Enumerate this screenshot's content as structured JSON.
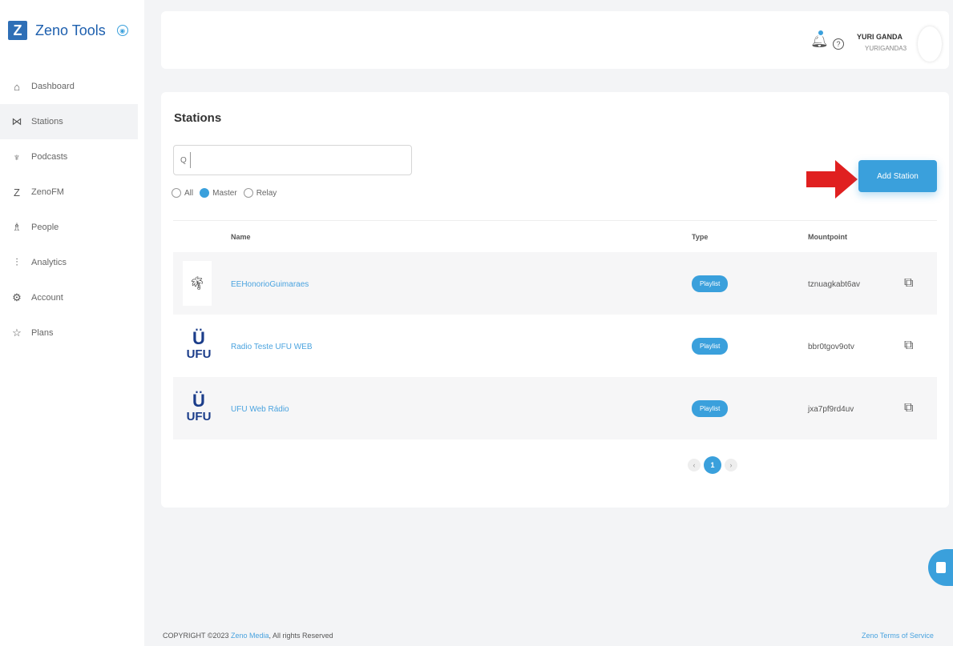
{
  "brand": {
    "logo": "Z",
    "name": "Zeno Tools",
    "toggle_icon": "collapse-circle-icon"
  },
  "sidebar": {
    "items": [
      {
        "label": "Dashboard",
        "icon": "⌂"
      },
      {
        "label": "Stations",
        "icon": "⋈"
      },
      {
        "label": "Podcasts",
        "icon": "♆"
      },
      {
        "label": "ZenoFM",
        "icon": "Z"
      },
      {
        "label": "People",
        "icon": "♗"
      },
      {
        "label": "Analytics",
        "icon": "⫶"
      },
      {
        "label": "Account",
        "icon": "⚙"
      },
      {
        "label": "Plans",
        "icon": "☆"
      }
    ],
    "active_index": 1
  },
  "header": {
    "user_name": "YURI GANDA",
    "user_handle": "YURIGANDA3"
  },
  "stations": {
    "title": "Stations",
    "search": {
      "placeholder": "",
      "value": ""
    },
    "filters": [
      {
        "label": "All",
        "checked": false
      },
      {
        "label": "Master",
        "checked": true
      },
      {
        "label": "Relay",
        "checked": false
      }
    ],
    "add_button": "Add Station",
    "columns": [
      "Name",
      "Type",
      "Mountpoint"
    ],
    "rows": [
      {
        "logo": "cartoon",
        "name": "EEHonorioGuimaraes",
        "type": "Playlist",
        "mountpoint": "tznuagkabt6av"
      },
      {
        "logo": "UFU",
        "name": "Radio Teste UFU WEB",
        "type": "Playlist",
        "mountpoint": "bbr0tgov9otv"
      },
      {
        "logo": "UFU",
        "name": "UFU Web Rádio",
        "type": "Playlist",
        "mountpoint": "jxa7pf9rd4uv"
      }
    ],
    "pagination": {
      "current": "1",
      "prev": "‹",
      "next": "›"
    }
  },
  "footer": {
    "copyright_prefix": "COPYRIGHT ©2023",
    "company": "Zeno Media",
    "copyright_suffix": ", All rights Reserved",
    "terms": "Zeno Terms of Service"
  },
  "colors": {
    "accent": "#3aa0dc",
    "brand": "#1d5fae",
    "arrow": "#e02020"
  }
}
